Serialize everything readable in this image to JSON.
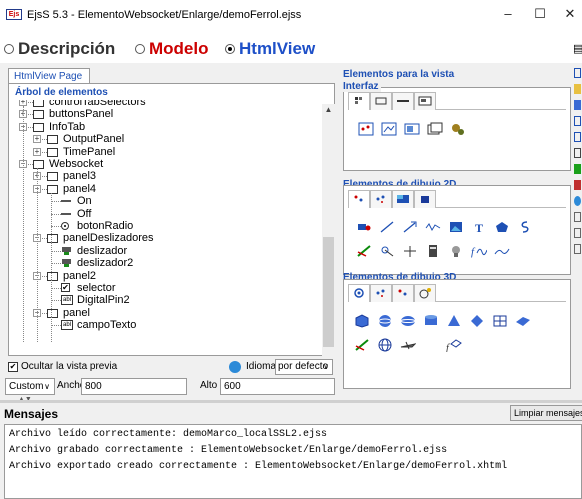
{
  "window": {
    "title": "EjsS 5.3 - ElementoWebsocket/Enlarge/demoFerrol.ejss",
    "icon_text": "Ejs",
    "minimize": "–",
    "maximize": "☐",
    "close": "✕"
  },
  "modes": [
    {
      "label": "Descripción",
      "selected": false,
      "color": "#333333"
    },
    {
      "label": "Modelo",
      "selected": false,
      "color": "#cc0000"
    },
    {
      "label": "HtmlView",
      "selected": true,
      "color": "#1e50c8"
    }
  ],
  "left": {
    "tab": "HtmlView Page",
    "tree_title": "Árbol de elementos",
    "tree": [
      {
        "label": "controlTabSelectors",
        "indent": 2,
        "icon": "folder",
        "expander": "+"
      },
      {
        "label": "buttonsPanel",
        "indent": 2,
        "icon": "folder",
        "expander": "+"
      },
      {
        "label": "InfoTab",
        "indent": 2,
        "icon": "folder",
        "expander": "-"
      },
      {
        "label": "OutputPanel",
        "indent": 3,
        "icon": "folder",
        "expander": "+"
      },
      {
        "label": "TimePanel",
        "indent": 3,
        "icon": "folder",
        "expander": "+"
      },
      {
        "label": "Websocket",
        "indent": 2,
        "icon": "folder",
        "expander": "-"
      },
      {
        "label": "panel3",
        "indent": 3,
        "icon": "folder",
        "expander": "+"
      },
      {
        "label": "panel4",
        "indent": 3,
        "icon": "folder",
        "expander": "-"
      },
      {
        "label": "On",
        "indent": 4,
        "icon": "line",
        "expander": ""
      },
      {
        "label": "Off",
        "indent": 4,
        "icon": "line",
        "expander": ""
      },
      {
        "label": "botonRadio",
        "indent": 4,
        "icon": "radio",
        "expander": ""
      },
      {
        "label": "panelDeslizadores",
        "indent": 3,
        "icon": "folder",
        "expander": "-"
      },
      {
        "label": "deslizador",
        "indent": 4,
        "icon": "slider",
        "expander": ""
      },
      {
        "label": "deslizador2",
        "indent": 4,
        "icon": "slider",
        "expander": ""
      },
      {
        "label": "panel2",
        "indent": 3,
        "icon": "folder",
        "expander": "-"
      },
      {
        "label": "selector",
        "indent": 4,
        "icon": "check",
        "expander": ""
      },
      {
        "label": "DigitalPin2",
        "indent": 4,
        "icon": "field",
        "expander": ""
      },
      {
        "label": "panel",
        "indent": 3,
        "icon": "folder",
        "expander": "-"
      },
      {
        "label": "campoTexto",
        "indent": 4,
        "icon": "field",
        "expander": ""
      }
    ],
    "hide_preview_label": "Ocultar la vista previa",
    "hide_preview_checked": true,
    "language_label": "Idioma:",
    "language_value": "por defecto",
    "size_preset": "Custom",
    "width_label": "Ancho",
    "width_value": "800",
    "height_label": "Alto",
    "height_value": "600",
    "field_icon_text": "abl"
  },
  "right": {
    "title": "Elementos para la vista",
    "group_interfaz": "Interfaz",
    "group_2d": "Elementos de dibujo 2D",
    "group_3d": "Elementos de dibujo 3D"
  },
  "messages": {
    "title": "Mensajes",
    "clear_button": "Limpiar mensajes",
    "lines": [
      "Archivo leído correctamente: demoMarco_localSSL2.ejss",
      "Archivo grabado correctamente : ElementoWebsocket/Enlarge/demoFerrol.ejss",
      "Archivo exportado creado correctamente : ElementoWebsocket/Enlarge/demoFerrol.xhtml"
    ]
  }
}
